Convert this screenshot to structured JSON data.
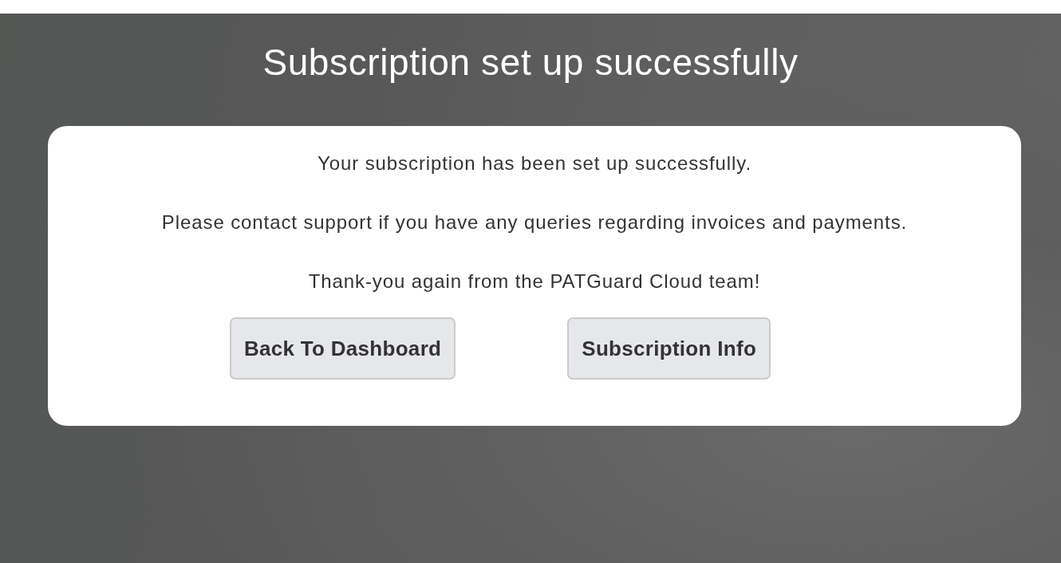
{
  "title": "Subscription set up successfully",
  "messages": [
    "Your subscription has been set up successfully.",
    "Please contact support if you have any queries regarding invoices and payments.",
    "Thank-you again from the PATGuard Cloud team!"
  ],
  "buttons": [
    {
      "label": "Back To Dashboard"
    },
    {
      "label": "Subscription Info"
    }
  ]
}
